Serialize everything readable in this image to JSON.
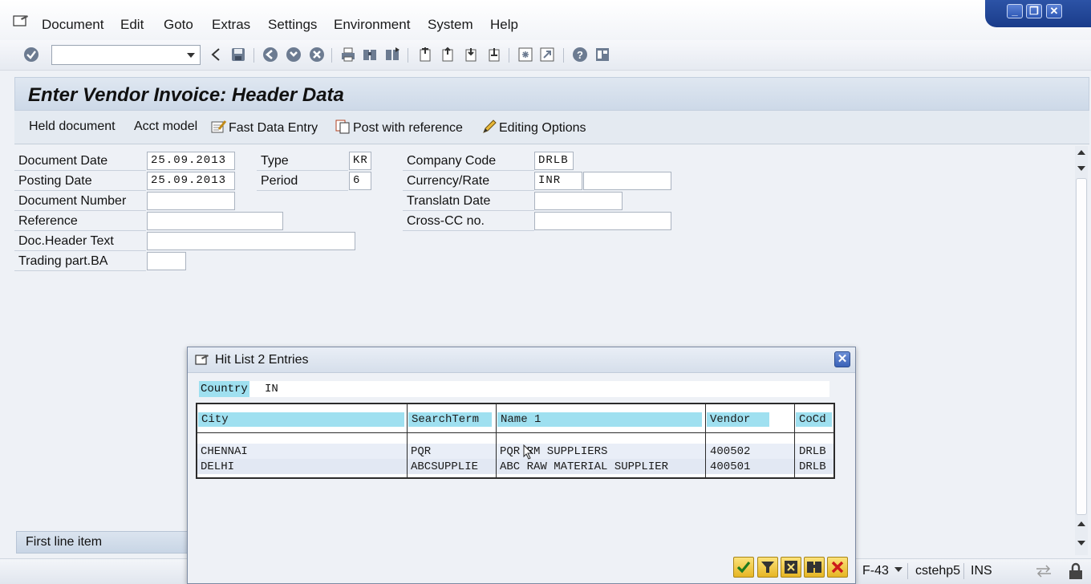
{
  "menu": {
    "items": [
      "Document",
      "Edit",
      "Goto",
      "Extras",
      "Settings",
      "Environment",
      "System",
      "Help"
    ]
  },
  "window_controls": [
    "minimize-icon",
    "restore-icon",
    "close-icon"
  ],
  "toolbar": {
    "command_field_value": "",
    "icons": [
      "enter-check-icon",
      "back-arrow-icon",
      "save-icon",
      "back-icon",
      "exit-icon",
      "cancel-icon",
      "print-icon",
      "find-icon",
      "find-next-icon",
      "first-page-icon",
      "previous-page-icon",
      "next-page-icon",
      "last-page-icon",
      "new-session-icon",
      "shortcut-icon",
      "help-icon",
      "customize-layout-icon"
    ]
  },
  "title": "Enter Vendor Invoice: Header Data",
  "app_toolbar": {
    "held_document": "Held document",
    "acct_model": "Acct model",
    "fast_data_entry": "Fast Data Entry",
    "post_with_reference": "Post with reference",
    "editing_options": "Editing Options"
  },
  "form": {
    "document_date": {
      "label": "Document Date",
      "value": "25.09.2013"
    },
    "posting_date": {
      "label": "Posting Date",
      "value": "25.09.2013"
    },
    "document_number": {
      "label": "Document Number",
      "value": ""
    },
    "reference": {
      "label": "Reference",
      "value": ""
    },
    "doc_header_text": {
      "label": "Doc.Header Text",
      "value": ""
    },
    "trading_part_ba": {
      "label": "Trading part.BA",
      "value": ""
    },
    "type": {
      "label": "Type",
      "value": "KR"
    },
    "period": {
      "label": "Period",
      "value": "6"
    },
    "company_code": {
      "label": "Company Code",
      "value": "DRLB"
    },
    "currency_rate": {
      "label": "Currency/Rate",
      "value": "INR",
      "rate": ""
    },
    "translatn_date": {
      "label": "Translatn Date",
      "value": ""
    },
    "cross_cc_no": {
      "label": "Cross-CC no.",
      "value": ""
    }
  },
  "first_line_item": "First line item",
  "status_bar": {
    "transaction": "F-43",
    "server": "cstehp5",
    "mode": "INS"
  },
  "dialog": {
    "title": "Hit List 2 Entries",
    "country_label": "Country",
    "country_value": "IN",
    "columns": [
      "City",
      "SearchTerm",
      "Name 1",
      "Vendor",
      "CoCd"
    ],
    "rows": [
      {
        "city": "CHENNAI",
        "search_term": "PQR",
        "name1": "PQR RM SUPPLIERS",
        "vendor": "400502",
        "cocd": "DRLB"
      },
      {
        "city": "DELHI",
        "search_term": "ABCSUPPLIE",
        "name1": "ABC RAW MATERIAL SUPPLIER",
        "vendor": "400501",
        "cocd": "DRLB"
      }
    ],
    "buttons": [
      "continue-check-icon",
      "restrictions-icon",
      "information-icon",
      "multiple-selection-icon",
      "cancel-x-icon"
    ]
  }
}
